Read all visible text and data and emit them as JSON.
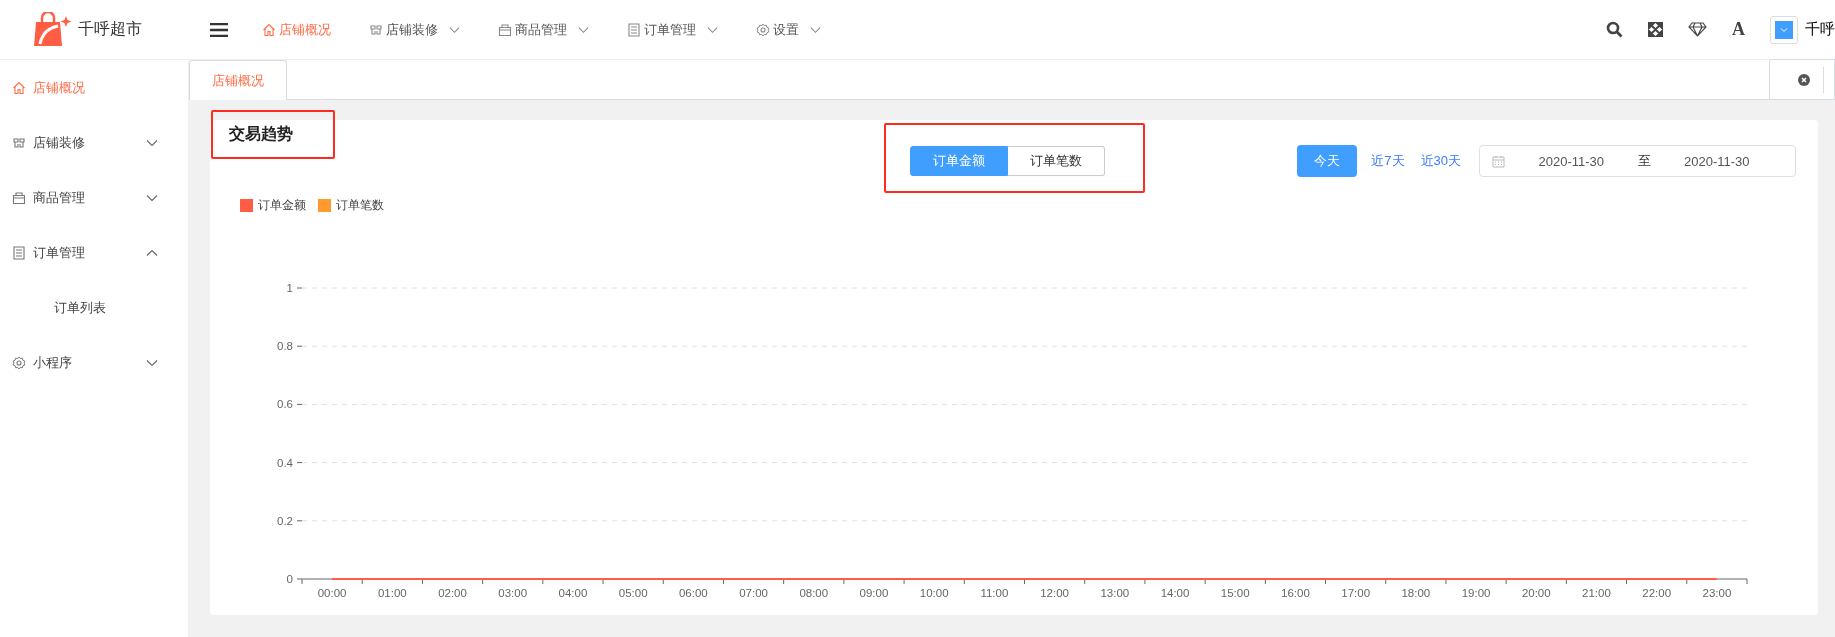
{
  "logo": {
    "name": "千呼超市"
  },
  "top_nav": [
    {
      "label": "店铺概况",
      "selected": true,
      "dropdown": false
    },
    {
      "label": "店铺装修",
      "selected": false,
      "dropdown": true
    },
    {
      "label": "商品管理",
      "selected": false,
      "dropdown": true
    },
    {
      "label": "订单管理",
      "selected": false,
      "dropdown": true
    },
    {
      "label": "设置",
      "selected": false,
      "dropdown": true
    }
  ],
  "header_tools": {
    "font_glyph": "A",
    "user_name": "千呼"
  },
  "sidebar": {
    "items": [
      {
        "label": "店铺概况",
        "selected": true
      },
      {
        "label": "店铺装修",
        "selected": false,
        "expanded": false
      },
      {
        "label": "商品管理",
        "selected": false,
        "expanded": false
      },
      {
        "label": "订单管理",
        "selected": false,
        "expanded": true,
        "children": [
          {
            "label": "订单列表",
            "selected": false
          }
        ]
      },
      {
        "label": "小程序",
        "selected": false,
        "expanded": false
      }
    ]
  },
  "tabs": [
    {
      "label": "店铺概况",
      "selected": true
    }
  ],
  "card": {
    "title": "交易趋势",
    "metric_toggle": [
      {
        "label": "订单金额",
        "selected": true
      },
      {
        "label": "订单笔数",
        "selected": false
      }
    ],
    "ranges": [
      {
        "label": "今天",
        "selected": true
      },
      {
        "label": "近7天",
        "selected": false
      },
      {
        "label": "近30天",
        "selected": false
      }
    ],
    "date_range": {
      "start": "2020-11-30",
      "separator": "至",
      "end": "2020-11-30"
    },
    "legend": [
      {
        "label": "订单金额",
        "color": "#ff5e44"
      },
      {
        "label": "订单笔数",
        "color": "#ff9a2e"
      }
    ],
    "chart_data": {
      "type": "line",
      "categories": [
        "00:00",
        "01:00",
        "02:00",
        "03:00",
        "04:00",
        "05:00",
        "06:00",
        "07:00",
        "08:00",
        "09:00",
        "10:00",
        "11:00",
        "12:00",
        "13:00",
        "14:00",
        "15:00",
        "16:00",
        "17:00",
        "18:00",
        "19:00",
        "20:00",
        "21:00",
        "22:00",
        "23:00"
      ],
      "series": [
        {
          "color": "#ff5e44",
          "values": [
            0,
            0,
            0,
            0,
            0,
            0,
            0,
            0,
            0,
            0,
            0,
            0,
            0,
            0,
            0,
            0,
            0,
            0,
            0,
            0,
            0,
            0,
            0,
            0
          ]
        }
      ],
      "ylim": [
        0,
        1
      ],
      "yticks": [
        0,
        0.2,
        0.4,
        0.6,
        0.8,
        1
      ],
      "grid": true
    }
  }
}
